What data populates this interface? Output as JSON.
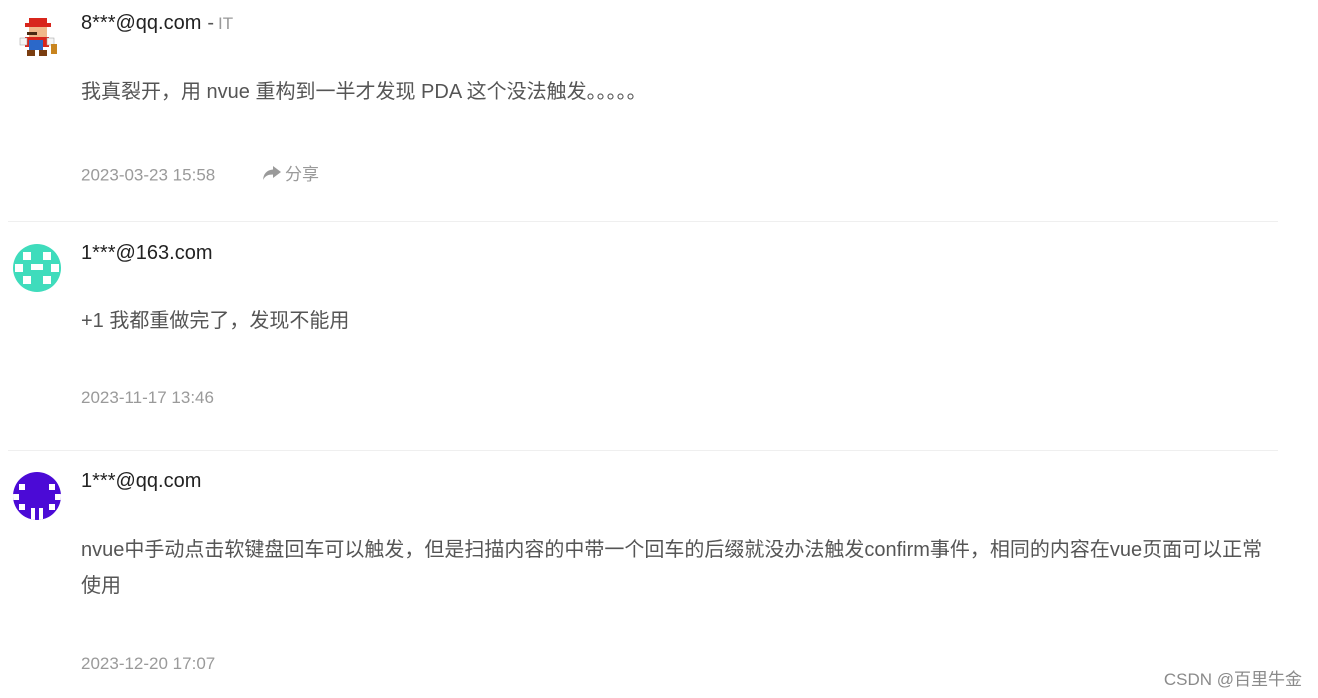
{
  "comments": [
    {
      "username": "8***@qq.com",
      "separator": "-",
      "tag": "IT",
      "text": "我真裂开，用 nvue 重构到一半才发现 PDA 这个没法触发。。。。。",
      "date": "2023-03-23 15:58",
      "share_label": "分享",
      "avatar": "mario-avatar-icon"
    },
    {
      "username": "1***@163.com",
      "text": "+1 我都重做完了，发现不能用",
      "date": "2023-11-17 13:46",
      "avatar": "identicon-avatar-icon",
      "avatar_color": "#3fdcbc"
    },
    {
      "username": "1***@qq.com",
      "text": "nvue中手动点击软键盘回车可以触发，但是扫描内容的中带一个回车的后缀就没办法触发confirm事件，相同的内容在vue页面可以正常使用",
      "date": "2023-12-20 17:07",
      "avatar": "identicon-avatar-icon",
      "avatar_color": "#4b0ad6"
    }
  ],
  "watermark": "CSDN @百里牛金"
}
